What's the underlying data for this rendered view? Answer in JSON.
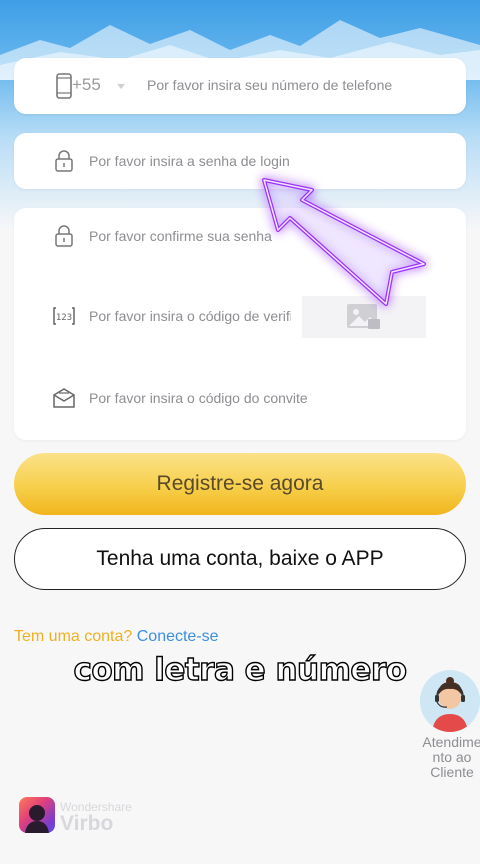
{
  "phone": {
    "country_code": "+55",
    "placeholder": "Por favor insira seu número de telefone"
  },
  "password": {
    "placeholder": "Por favor insira a senha de login"
  },
  "confirm_password": {
    "placeholder": "Por favor confirme sua senha"
  },
  "verification": {
    "placeholder": "Por favor insira o código de verificação"
  },
  "invite": {
    "placeholder": "Por favor insira o código do convite"
  },
  "buttons": {
    "register": "Registre-se agora",
    "download": "Tenha uma conta, baixe o APP"
  },
  "login_prompt": {
    "question": "Tem uma conta?",
    "link": "Conecte-se"
  },
  "caption": "com letra e número",
  "support": {
    "label": "Atendime\nnto ao\nCliente"
  },
  "watermark": {
    "brand": "Wondershare",
    "product": "Virbo"
  },
  "colors": {
    "register_button": "#f7cf4b",
    "link": "#3d8ee0",
    "question": "#f0b020",
    "highlight_arrow": "#9b30ff"
  }
}
